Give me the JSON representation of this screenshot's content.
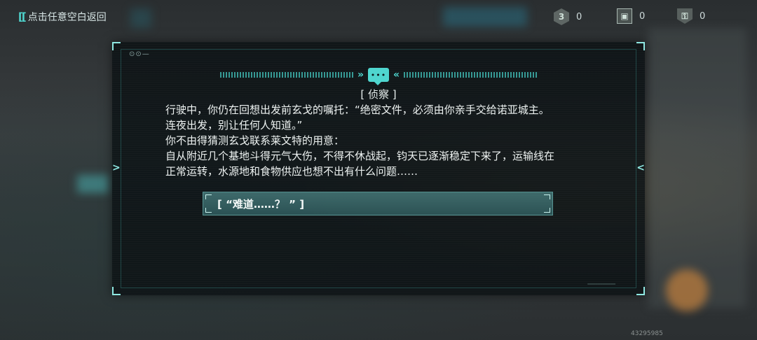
{
  "topbar": {
    "back_label": "点击任意空白返回",
    "back_icon": "back-bracket-icon"
  },
  "resources": [
    {
      "icon": "hexagon-3-icon",
      "glyph": "3",
      "value": "0"
    },
    {
      "icon": "crate-icon",
      "glyph": "▣",
      "value": "0"
    },
    {
      "icon": "badge-tag-icon",
      "glyph": "⚿",
      "value": "0"
    }
  ],
  "dialog": {
    "corner_mark": "⊙⊙—",
    "chat_icon_glyph": "•••",
    "title": "[ 侦察 ]",
    "body": [
      "行驶中，你仍在回想出发前玄戈的嘱托：“绝密文件，必须由你亲手交给诺亚城主。",
      "连夜出发，别让任何人知道。”",
      "你不由得猜测玄戈联系莱文特的用意：",
      "自从附近几个基地斗得元气大伤，不得不休战起，钧天已逐渐稳定下来了，运输线在",
      "正常运转，水源地和食物供应也想不出有什么问题……"
    ],
    "choice_label": "[ “难道……？ ” ]"
  },
  "watermark": "43295985",
  "colors": {
    "accent": "#4fd6cf",
    "choice_bg": "#3e7476",
    "panel_bg": "#0a1012"
  }
}
